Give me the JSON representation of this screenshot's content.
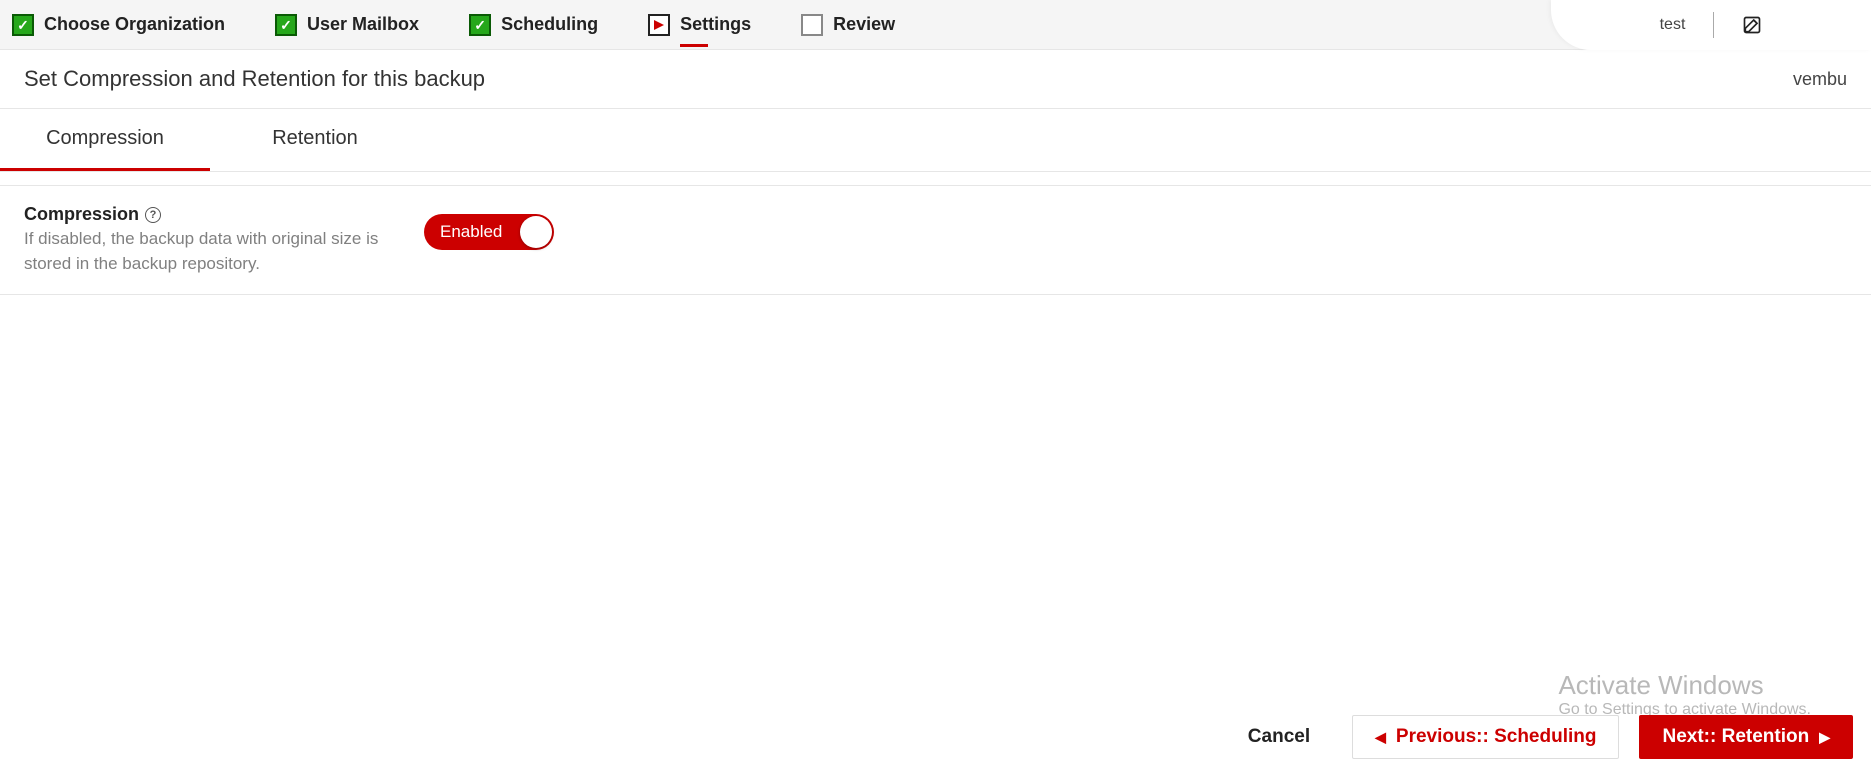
{
  "wizard": {
    "steps": [
      {
        "label": "Choose Organization",
        "state": "done"
      },
      {
        "label": "User Mailbox",
        "state": "done"
      },
      {
        "label": "Scheduling",
        "state": "done"
      },
      {
        "label": "Settings",
        "state": "current"
      },
      {
        "label": "Review",
        "state": "todo"
      }
    ]
  },
  "top_right": {
    "job_name": "test"
  },
  "subheader": {
    "title": "Set Compression and Retention for this backup",
    "vendor": "vembu"
  },
  "tabs": [
    {
      "label": "Compression",
      "active": true
    },
    {
      "label": "Retention",
      "active": false
    }
  ],
  "compression": {
    "title": "Compression",
    "description": "If disabled, the backup data with original size is stored in the backup repository.",
    "toggle_label": "Enabled"
  },
  "footer": {
    "cancel": "Cancel",
    "previous": "Previous:: Scheduling",
    "next": "Next:: Retention"
  },
  "watermark": {
    "line1": "Activate Windows",
    "line2": "Go to Settings to activate Windows."
  }
}
